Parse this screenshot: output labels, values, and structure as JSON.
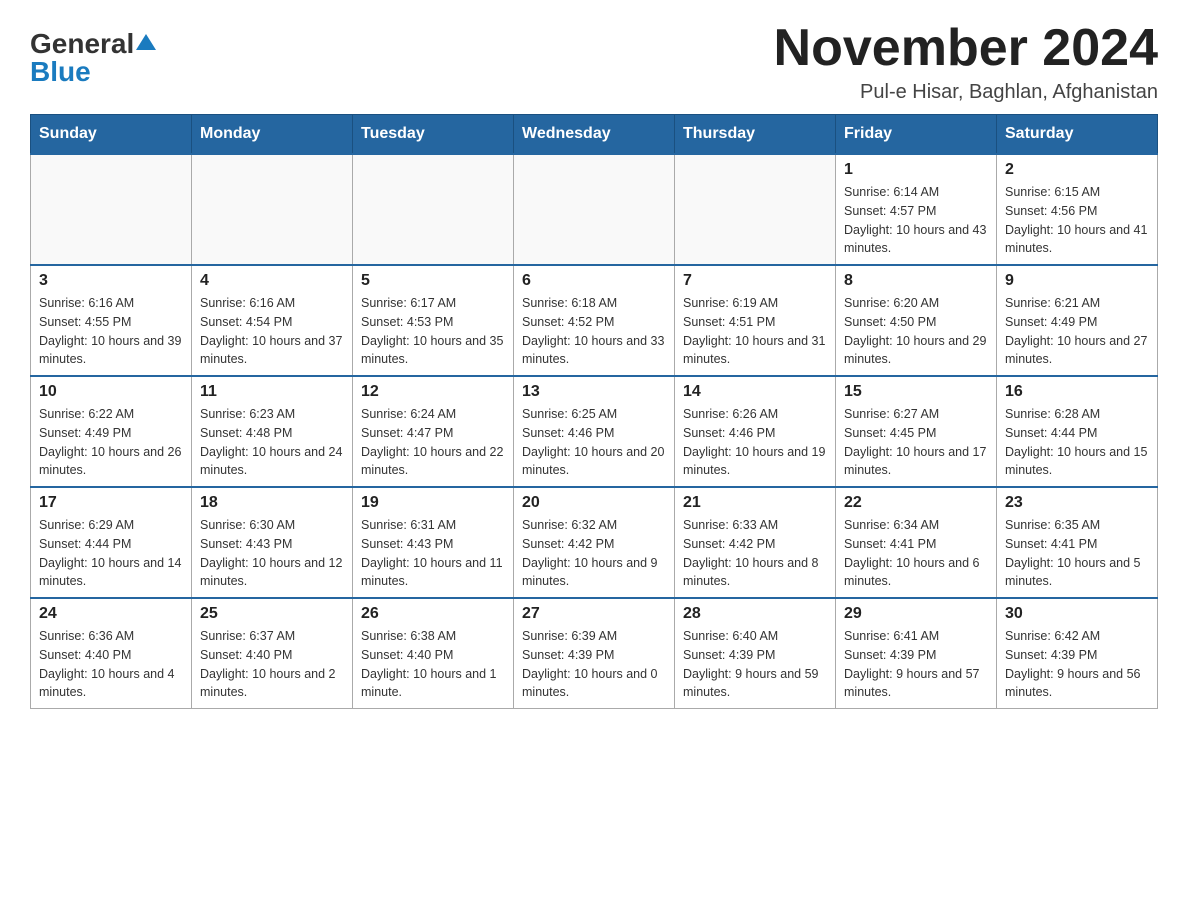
{
  "header": {
    "logo_general": "General",
    "logo_blue": "Blue",
    "month_title": "November 2024",
    "location": "Pul-e Hisar, Baghlan, Afghanistan"
  },
  "weekdays": [
    "Sunday",
    "Monday",
    "Tuesday",
    "Wednesday",
    "Thursday",
    "Friday",
    "Saturday"
  ],
  "weeks": [
    [
      {
        "day": "",
        "info": ""
      },
      {
        "day": "",
        "info": ""
      },
      {
        "day": "",
        "info": ""
      },
      {
        "day": "",
        "info": ""
      },
      {
        "day": "",
        "info": ""
      },
      {
        "day": "1",
        "info": "Sunrise: 6:14 AM\nSunset: 4:57 PM\nDaylight: 10 hours and 43 minutes."
      },
      {
        "day": "2",
        "info": "Sunrise: 6:15 AM\nSunset: 4:56 PM\nDaylight: 10 hours and 41 minutes."
      }
    ],
    [
      {
        "day": "3",
        "info": "Sunrise: 6:16 AM\nSunset: 4:55 PM\nDaylight: 10 hours and 39 minutes."
      },
      {
        "day": "4",
        "info": "Sunrise: 6:16 AM\nSunset: 4:54 PM\nDaylight: 10 hours and 37 minutes."
      },
      {
        "day": "5",
        "info": "Sunrise: 6:17 AM\nSunset: 4:53 PM\nDaylight: 10 hours and 35 minutes."
      },
      {
        "day": "6",
        "info": "Sunrise: 6:18 AM\nSunset: 4:52 PM\nDaylight: 10 hours and 33 minutes."
      },
      {
        "day": "7",
        "info": "Sunrise: 6:19 AM\nSunset: 4:51 PM\nDaylight: 10 hours and 31 minutes."
      },
      {
        "day": "8",
        "info": "Sunrise: 6:20 AM\nSunset: 4:50 PM\nDaylight: 10 hours and 29 minutes."
      },
      {
        "day": "9",
        "info": "Sunrise: 6:21 AM\nSunset: 4:49 PM\nDaylight: 10 hours and 27 minutes."
      }
    ],
    [
      {
        "day": "10",
        "info": "Sunrise: 6:22 AM\nSunset: 4:49 PM\nDaylight: 10 hours and 26 minutes."
      },
      {
        "day": "11",
        "info": "Sunrise: 6:23 AM\nSunset: 4:48 PM\nDaylight: 10 hours and 24 minutes."
      },
      {
        "day": "12",
        "info": "Sunrise: 6:24 AM\nSunset: 4:47 PM\nDaylight: 10 hours and 22 minutes."
      },
      {
        "day": "13",
        "info": "Sunrise: 6:25 AM\nSunset: 4:46 PM\nDaylight: 10 hours and 20 minutes."
      },
      {
        "day": "14",
        "info": "Sunrise: 6:26 AM\nSunset: 4:46 PM\nDaylight: 10 hours and 19 minutes."
      },
      {
        "day": "15",
        "info": "Sunrise: 6:27 AM\nSunset: 4:45 PM\nDaylight: 10 hours and 17 minutes."
      },
      {
        "day": "16",
        "info": "Sunrise: 6:28 AM\nSunset: 4:44 PM\nDaylight: 10 hours and 15 minutes."
      }
    ],
    [
      {
        "day": "17",
        "info": "Sunrise: 6:29 AM\nSunset: 4:44 PM\nDaylight: 10 hours and 14 minutes."
      },
      {
        "day": "18",
        "info": "Sunrise: 6:30 AM\nSunset: 4:43 PM\nDaylight: 10 hours and 12 minutes."
      },
      {
        "day": "19",
        "info": "Sunrise: 6:31 AM\nSunset: 4:43 PM\nDaylight: 10 hours and 11 minutes."
      },
      {
        "day": "20",
        "info": "Sunrise: 6:32 AM\nSunset: 4:42 PM\nDaylight: 10 hours and 9 minutes."
      },
      {
        "day": "21",
        "info": "Sunrise: 6:33 AM\nSunset: 4:42 PM\nDaylight: 10 hours and 8 minutes."
      },
      {
        "day": "22",
        "info": "Sunrise: 6:34 AM\nSunset: 4:41 PM\nDaylight: 10 hours and 6 minutes."
      },
      {
        "day": "23",
        "info": "Sunrise: 6:35 AM\nSunset: 4:41 PM\nDaylight: 10 hours and 5 minutes."
      }
    ],
    [
      {
        "day": "24",
        "info": "Sunrise: 6:36 AM\nSunset: 4:40 PM\nDaylight: 10 hours and 4 minutes."
      },
      {
        "day": "25",
        "info": "Sunrise: 6:37 AM\nSunset: 4:40 PM\nDaylight: 10 hours and 2 minutes."
      },
      {
        "day": "26",
        "info": "Sunrise: 6:38 AM\nSunset: 4:40 PM\nDaylight: 10 hours and 1 minute."
      },
      {
        "day": "27",
        "info": "Sunrise: 6:39 AM\nSunset: 4:39 PM\nDaylight: 10 hours and 0 minutes."
      },
      {
        "day": "28",
        "info": "Sunrise: 6:40 AM\nSunset: 4:39 PM\nDaylight: 9 hours and 59 minutes."
      },
      {
        "day": "29",
        "info": "Sunrise: 6:41 AM\nSunset: 4:39 PM\nDaylight: 9 hours and 57 minutes."
      },
      {
        "day": "30",
        "info": "Sunrise: 6:42 AM\nSunset: 4:39 PM\nDaylight: 9 hours and 56 minutes."
      }
    ]
  ]
}
